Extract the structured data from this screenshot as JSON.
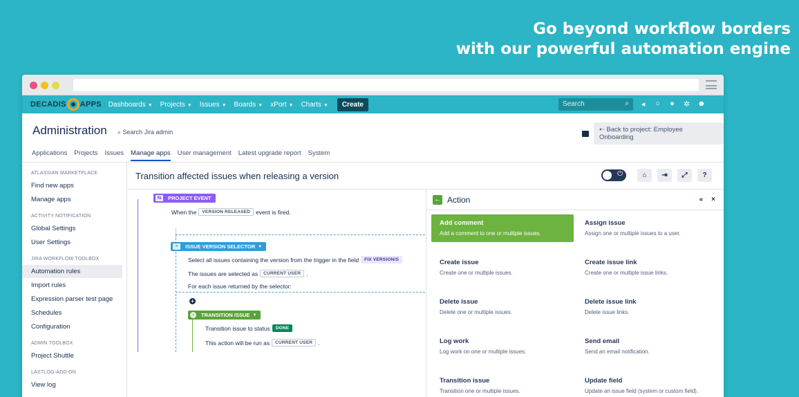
{
  "headline": {
    "line1": "Go beyond workflow borders",
    "line2": "with our powerful automation engine"
  },
  "topnav": {
    "logo_left": "DECADIS",
    "logo_right": "APPS",
    "items": [
      "Dashboards",
      "Projects",
      "Issues",
      "Boards",
      "xPort",
      "Charts"
    ],
    "create_label": "Create",
    "search_placeholder": "Search"
  },
  "admin": {
    "title": "Administration",
    "search_label": "Search Jira admin",
    "back_label": "Back to project: Employee Onboarding"
  },
  "tabs": [
    "Applications",
    "Projects",
    "Issues",
    "Manage apps",
    "User management",
    "Latest upgrade report",
    "System"
  ],
  "sidebar": {
    "sections": [
      {
        "heading": "ATLASSIAN MARKETPLACE",
        "items": [
          "Find new apps",
          "Manage apps"
        ]
      },
      {
        "heading": "ACTIVITY NOTIFICATION",
        "items": [
          "Global Settings",
          "User Settings"
        ]
      },
      {
        "heading": "JIRA WORKFLOW TOOLBOX",
        "items": [
          "Automation rules",
          "Import rules",
          "Expression parser test page",
          "Schedules",
          "Configuration"
        ]
      },
      {
        "heading": "ADMIN TOOLBOX",
        "items": [
          "Project Shuttle"
        ]
      },
      {
        "heading": "LASTLOG-ADD-ON",
        "items": [
          "View log"
        ]
      }
    ],
    "active_item": "Automation rules"
  },
  "rule": {
    "title": "Transition affected issues when releasing a version"
  },
  "flow": {
    "event_badge": "PROJECT EVENT",
    "event_prefix": "When the",
    "event_lozenge": "VERSION RELEASED",
    "event_suffix": "event is fired.",
    "selector_badge": "ISSUE VERSION SELECTOR",
    "selector_line1": "Select all issues containing the version from the trigger in the field",
    "selector_lozenge": "FIX VERSION/S",
    "selected_prefix": "The issues are selected as",
    "selected_lozenge": "CURRENT USER",
    "selected_suffix": ".",
    "foreach_line": "For each issue returned by the selector:",
    "transition_badge": "TRANSITION ISSUE",
    "transition_prefix": "Transition issue to status",
    "transition_lozenge": "DONE",
    "runas_prefix": "This action will be run as",
    "runas_lozenge": "CURRENT USER",
    "runas_suffix": "."
  },
  "action_panel": {
    "title": "Action",
    "cards": [
      {
        "title": "Add comment",
        "desc": "Add a comment to one or multiple issues."
      },
      {
        "title": "Assign issue",
        "desc": "Assign one or multiple issues to a user."
      },
      {
        "title": "Create issue",
        "desc": "Create one or multiple issues."
      },
      {
        "title": "Create issue link",
        "desc": "Create one or multiple issue links."
      },
      {
        "title": "Delete issue",
        "desc": "Delete one or multiple issues."
      },
      {
        "title": "Delete issue link",
        "desc": "Delete issue links."
      },
      {
        "title": "Log work",
        "desc": "Log work on one or multiple issues."
      },
      {
        "title": "Send email",
        "desc": "Send an email notification."
      },
      {
        "title": "Transition issue",
        "desc": "Transition one or multiple issues."
      },
      {
        "title": "Update field",
        "desc": "Update an issue field (system or custom field)."
      }
    ]
  },
  "colors": {
    "brand": "#2bb5c6",
    "selected_card": "#6cb33f",
    "event_badge": "#8b5cf6",
    "selector_badge": "#2f9ed8",
    "transition_badge": "#5aa33a"
  }
}
